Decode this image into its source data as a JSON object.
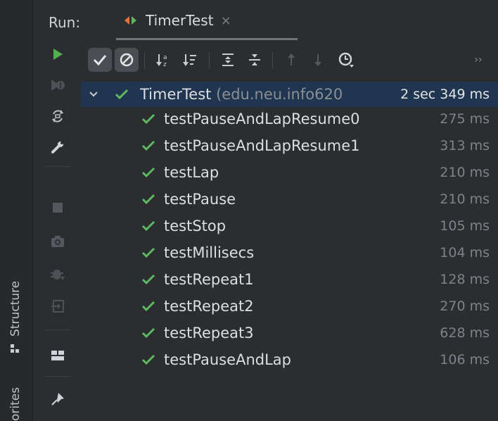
{
  "window": {
    "run_label": "Run:",
    "tab_title": "TimerTest",
    "tab_close": "×"
  },
  "left_edge": {
    "structure_label": "Structure",
    "favorites_label": "orites"
  },
  "toolbar": {
    "icons": [
      "show-passed-icon",
      "show-ignored-icon",
      "sort-alpha-icon",
      "sort-duration-icon",
      "expand-all-icon",
      "collapse-all-icon",
      "prev-failed-icon",
      "next-failed-icon",
      "test-history-icon",
      "more-icon"
    ],
    "more_glyph": "››"
  },
  "side_toolbar": {
    "icons": [
      "rerun-icon",
      "rerun-failed-icon",
      "toggle-auto-test-icon",
      "settings-wrench-icon",
      "stop-icon",
      "screenshot-camera-icon",
      "debug-bug-icon",
      "import-test-results-icon",
      "layout-icon",
      "pin-icon"
    ]
  },
  "tree": {
    "root": {
      "name": "TimerTest",
      "package": "(edu.neu.info620",
      "duration": "2 sec 349 ms"
    },
    "tests": [
      {
        "name": "testPauseAndLapResume0",
        "duration": "275 ms"
      },
      {
        "name": "testPauseAndLapResume1",
        "duration": "313 ms"
      },
      {
        "name": "testLap",
        "duration": "210 ms"
      },
      {
        "name": "testPause",
        "duration": "210 ms"
      },
      {
        "name": "testStop",
        "duration": "105 ms"
      },
      {
        "name": "testMillisecs",
        "duration": "104 ms"
      },
      {
        "name": "testRepeat1",
        "duration": "128 ms"
      },
      {
        "name": "testRepeat2",
        "duration": "270 ms"
      },
      {
        "name": "testRepeat3",
        "duration": "628 ms"
      },
      {
        "name": "testPauseAndLap",
        "duration": "106 ms"
      }
    ]
  },
  "colors": {
    "background": "#2b2d30",
    "selection": "#1f3550",
    "pass_green": "#5fb85f",
    "run_green": "#4fb04f"
  }
}
